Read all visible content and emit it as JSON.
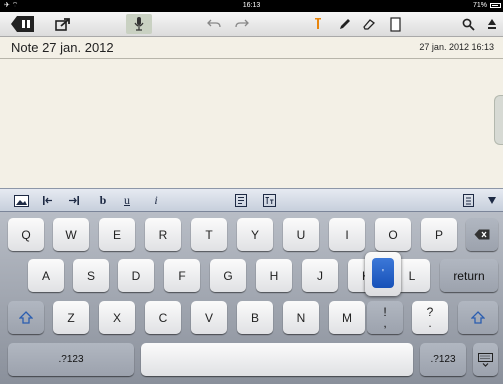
{
  "status_bar": {
    "time": "16:13",
    "battery": "71%"
  },
  "note": {
    "title": "Note 27 jan. 2012",
    "date": "27 jan. 2012 16:13"
  },
  "keyboard": {
    "row1": [
      "Q",
      "W",
      "E",
      "R",
      "T",
      "Y",
      "U",
      "I",
      "O",
      "P"
    ],
    "row2": [
      "A",
      "S",
      "D",
      "F",
      "G",
      "H",
      "J",
      "K",
      "L"
    ],
    "row3": [
      "Z",
      "X",
      "C",
      "V",
      "B",
      "N",
      "M"
    ],
    "return_label": "return",
    "numbers_label": ".?123",
    "excl_key": {
      "top": "!",
      "bottom": ","
    },
    "question_key": {
      "top": "?",
      "bottom": "."
    },
    "popup_char": "'"
  },
  "format_bar": {
    "bold": "b",
    "underline": "u",
    "italic": "i"
  },
  "colors": {
    "accent": "#1751b8",
    "paper": "#f3f0e6",
    "orange_icon": "#e8850c"
  }
}
